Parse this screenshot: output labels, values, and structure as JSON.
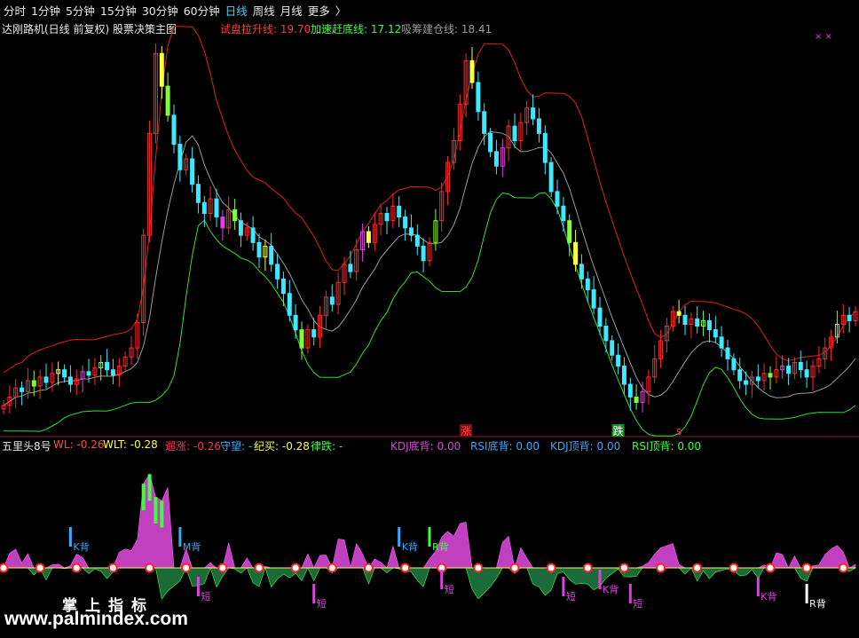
{
  "tabs": [
    {
      "label": "分时",
      "active": false
    },
    {
      "label": "1分钟",
      "active": false
    },
    {
      "label": "5分钟",
      "active": false
    },
    {
      "label": "15分钟",
      "active": false
    },
    {
      "label": "30分钟",
      "active": false
    },
    {
      "label": "60分钟",
      "active": false
    },
    {
      "label": "日线",
      "active": true
    },
    {
      "label": "周线",
      "active": false
    },
    {
      "label": "月线",
      "active": false
    },
    {
      "label": "更多",
      "active": false
    }
  ],
  "more_arrow": "〉",
  "main_panel": {
    "title": "达刚路机(日线 前复权) 股票决策主图",
    "legend": [
      {
        "label": "试盘拉升线: 19.70",
        "color": "#ff3b3b"
      },
      {
        "label": "加速赶底线: 17.12",
        "color": "#3dff3d"
      },
      {
        "label": "吸筹建仓线: 18.41",
        "color": "#9a9a9a"
      }
    ],
    "markers": [
      {
        "text": "涨",
        "color": "#ff4040",
        "bg": "#7a1010",
        "index": 76
      },
      {
        "text": "跌",
        "color": "#ffffff",
        "bg": "#1e8a2a",
        "index": 101
      },
      {
        "text": "s",
        "color": "#ff3030",
        "bg": "",
        "index": 111
      }
    ],
    "corner_marks": "× ×"
  },
  "indicator_panel": {
    "name": "五里头8号",
    "values": [
      {
        "label": "WL: -0.26",
        "color": "#ff4a4a"
      },
      {
        "label": "WLT: -0.28",
        "color": "#ffff40"
      },
      {
        "label": "遛涨: -0.26",
        "color": "#ff2d5a"
      },
      {
        "label": "守望: -",
        "color": "#3aa8ff"
      },
      {
        "label": "纪买: -0.28",
        "color": "#ffff40"
      },
      {
        "label": "律跌: -",
        "color": "#3dff3d"
      },
      {
        "label": "KDJ底背: 0.00",
        "color": "#e040e0"
      },
      {
        "label": "RSI底背: 0.00",
        "color": "#3aa8ff"
      },
      {
        "label": "KDJ顶背: 0.00",
        "color": "#3aa8ff"
      },
      {
        "label": "RSI顶背: 0.00",
        "color": "#3dff3d"
      }
    ],
    "signals": [
      {
        "text": "K背",
        "color": "#3aa8ff",
        "index": 11
      },
      {
        "text": "M背",
        "color": "#3aa8ff",
        "index": 29
      },
      {
        "text": "K背",
        "color": "#3aa8ff",
        "index": 65
      },
      {
        "text": "R背",
        "color": "#3dff3d",
        "index": 70
      },
      {
        "text": "短",
        "color": "#e040e0",
        "index": 32
      },
      {
        "text": "短",
        "color": "#e040e0",
        "index": 51
      },
      {
        "text": "短",
        "color": "#e040e0",
        "index": 72
      },
      {
        "text": "短",
        "color": "#e040e0",
        "index": 92
      },
      {
        "text": "短",
        "color": "#e040e0",
        "index": 103
      },
      {
        "text": "K背",
        "color": "#e040e0",
        "index": 98
      },
      {
        "text": "K背",
        "color": "#e040e0",
        "index": 124
      },
      {
        "text": "R背",
        "color": "#ffffff",
        "index": 132
      }
    ]
  },
  "watermark": {
    "chinese": "掌上指标",
    "url": "www.palmindex.com"
  },
  "chart_data": {
    "type": "candlestick",
    "series_names": [
      "试盘拉升线",
      "加速赶底线",
      "吸筹建仓线"
    ],
    "close": [
      17.12,
      17.35,
      17.6,
      17.5,
      17.8,
      17.65,
      17.9,
      17.75,
      18.0,
      18.1,
      17.9,
      17.7,
      17.85,
      18.05,
      17.95,
      18.15,
      18.3,
      18.1,
      17.95,
      18.2,
      18.45,
      18.7,
      19.4,
      21.8,
      24.6,
      26.8,
      25.9,
      25.1,
      24.3,
      23.6,
      23.9,
      23.2,
      22.7,
      22.4,
      22.8,
      22.3,
      22.0,
      22.5,
      22.2,
      21.8,
      22.0,
      21.6,
      21.2,
      21.5,
      21.0,
      20.6,
      20.2,
      19.6,
      19.2,
      18.7,
      19.2,
      19.0,
      19.6,
      20.1,
      19.9,
      20.5,
      21.0,
      20.8,
      21.4,
      21.9,
      21.6,
      22.1,
      22.4,
      22.2,
      22.6,
      22.3,
      22.0,
      21.8,
      21.5,
      21.1,
      21.6,
      22.2,
      23.0,
      23.8,
      24.4,
      25.4,
      26.6,
      26.0,
      25.2,
      24.6,
      24.1,
      23.7,
      24.2,
      24.8,
      24.4,
      24.9,
      25.3,
      25.0,
      24.6,
      23.8,
      23.0,
      22.6,
      22.2,
      21.6,
      21.0,
      20.6,
      20.3,
      19.8,
      19.3,
      18.9,
      18.5,
      18.2,
      17.7,
      17.35,
      17.2,
      17.5,
      17.9,
      18.4,
      18.9,
      19.3,
      19.7,
      19.6,
      19.35,
      19.5,
      19.3,
      19.45,
      19.2,
      19.0,
      18.7,
      18.4,
      18.1,
      17.8,
      17.7,
      17.9,
      17.8,
      18.0,
      17.9,
      18.1,
      18.2,
      18.0,
      18.3,
      18.1,
      17.9,
      18.2,
      18.4,
      18.7,
      19.0,
      19.35,
      19.6,
      19.45,
      19.7
    ],
    "ohlc_note": "open/high/low derived approximately around close",
    "lines": {
      "试盘拉升线_last": 19.7,
      "加速赶底线_last": 17.12,
      "吸筹建仓线_last": 18.41
    },
    "ylim": [
      16.8,
      27.0
    ],
    "indicator_ylim": [
      -4.0,
      8.0
    ]
  }
}
